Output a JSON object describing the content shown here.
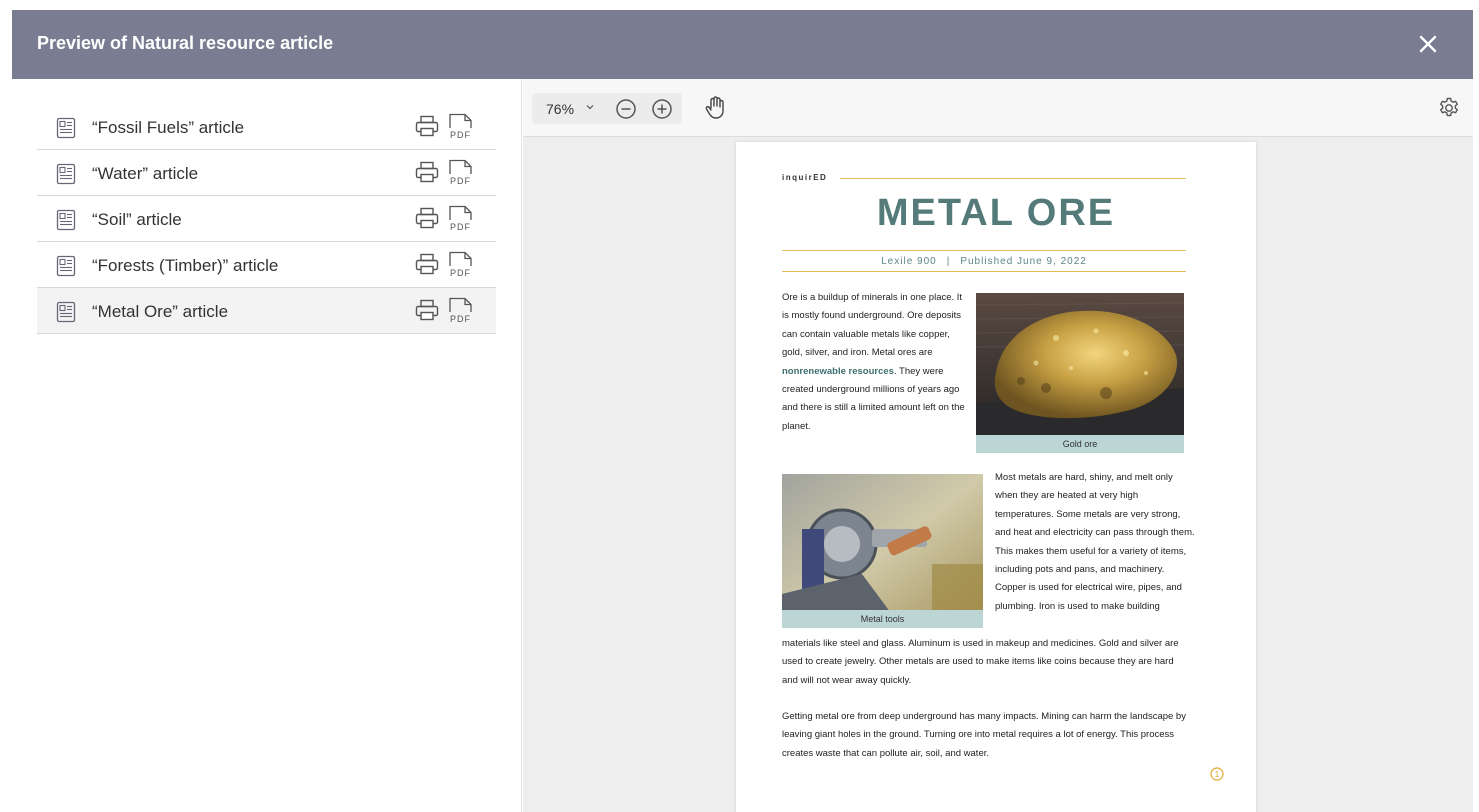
{
  "modal": {
    "title": "Preview of Natural resource article",
    "close_icon": "close-icon"
  },
  "articles": [
    {
      "label": "“Fossil Fuels” article",
      "selected": false
    },
    {
      "label": "“Water” article",
      "selected": false
    },
    {
      "label": "“Soil” article",
      "selected": false
    },
    {
      "label": "“Forests (Timber)” article",
      "selected": false
    },
    {
      "label": "“Metal Ore” article",
      "selected": true
    }
  ],
  "article_icons": {
    "document": "document-icon",
    "print": "printer-icon",
    "pdf": "pdf-icon",
    "pdf_text": "PDF"
  },
  "toolbar": {
    "zoom": "76%",
    "zoom_caret": "chevron-down-icon",
    "zoom_out": "zoom-out-icon",
    "zoom_in": "zoom-in-icon",
    "pan": "hand-icon",
    "settings": "gear-icon"
  },
  "document": {
    "brand": "inquirED",
    "title": "METAL ORE",
    "lexile": "Lexile 900",
    "published": "Published June 9, 2022",
    "p1_a": "Ore is a buildup of minerals in one place. It is mostly found underground. Ore deposits can contain valuable metals like copper, gold, silver, and iron. Metal ores are ",
    "p1_kw": "nonrenewable resources",
    "p1_b": ". They were created underground millions of years ago and there is still a limited amount left on the planet.",
    "fig1_caption": "Gold ore",
    "fig2_caption": "Metal tools",
    "p2": "Most metals are hard, shiny, and melt only when they are heated at very high temperatures. Some metals are very strong, and heat and electricity can pass through them. This makes them useful for a variety of items, including pots and pans, and machinery. Copper is used for electrical wire, pipes, and plumbing. Iron is used to make building",
    "p2b": "materials like steel and glass. Aluminum is used in makeup and medicines. Gold and silver are used to create jewelry. Other metals are used to make items like coins because they are hard and will not wear away quickly.",
    "p3": "Getting metal ore from deep underground has many impacts. Mining can harm the landscape by leaving giant holes in the ground. Turning ore into metal requires a lot of energy. This process creates waste that can pollute air, soil, and water.",
    "page_marker": "1"
  },
  "colors": {
    "header_bg": "#7a7d91",
    "accent_teal": "#547a7a",
    "rule_gold": "#e2bc57",
    "caption_bg": "#bcd5d5",
    "selected_row": "#f3f3f3"
  }
}
